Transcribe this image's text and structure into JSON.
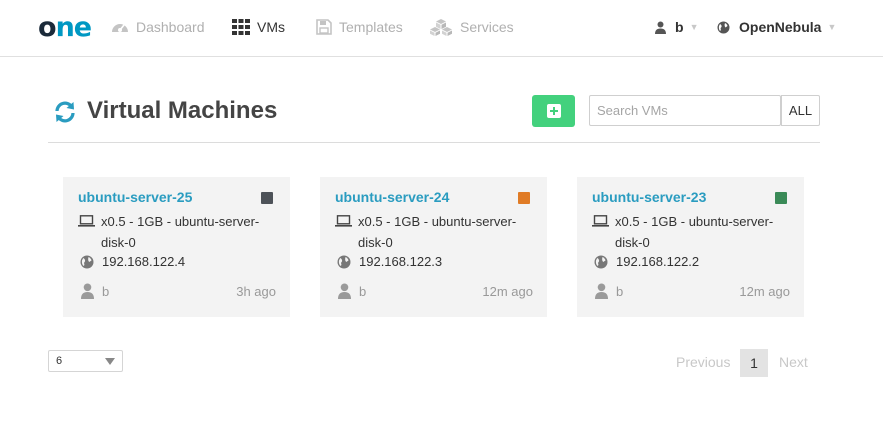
{
  "nav": {
    "logo": {
      "part1": "o",
      "part2": "n",
      "part3": "e"
    },
    "items": [
      {
        "label": "Dashboard",
        "icon": "dashboard-icon"
      },
      {
        "label": "VMs",
        "icon": "grid-icon",
        "active": true
      },
      {
        "label": "Templates",
        "icon": "save-icon"
      },
      {
        "label": "Services",
        "icon": "cubes-icon"
      }
    ],
    "user": "b",
    "zone": "OpenNebula"
  },
  "header": {
    "title": "Virtual Machines",
    "search_placeholder": "Search VMs",
    "filter_label": "ALL",
    "add_color": "#43d17d"
  },
  "vms": [
    {
      "name": "ubuntu-server-25",
      "state_color": "#4d5258",
      "spec": "x0.5 - 1GB - ubuntu-server-disk-0",
      "ip": "192.168.122.4",
      "owner": "b",
      "age": "3h ago"
    },
    {
      "name": "ubuntu-server-24",
      "state_color": "#e07b25",
      "spec": "x0.5 - 1GB - ubuntu-server-disk-0",
      "ip": "192.168.122.3",
      "owner": "b",
      "age": "12m ago"
    },
    {
      "name": "ubuntu-server-23",
      "state_color": "#3a8a57",
      "spec": "x0.5 - 1GB - ubuntu-server-disk-0",
      "ip": "192.168.122.2",
      "owner": "b",
      "age": "12m ago"
    }
  ],
  "pagination": {
    "page_size": "6",
    "previous": "Previous",
    "current_page": "1",
    "next": "Next"
  }
}
